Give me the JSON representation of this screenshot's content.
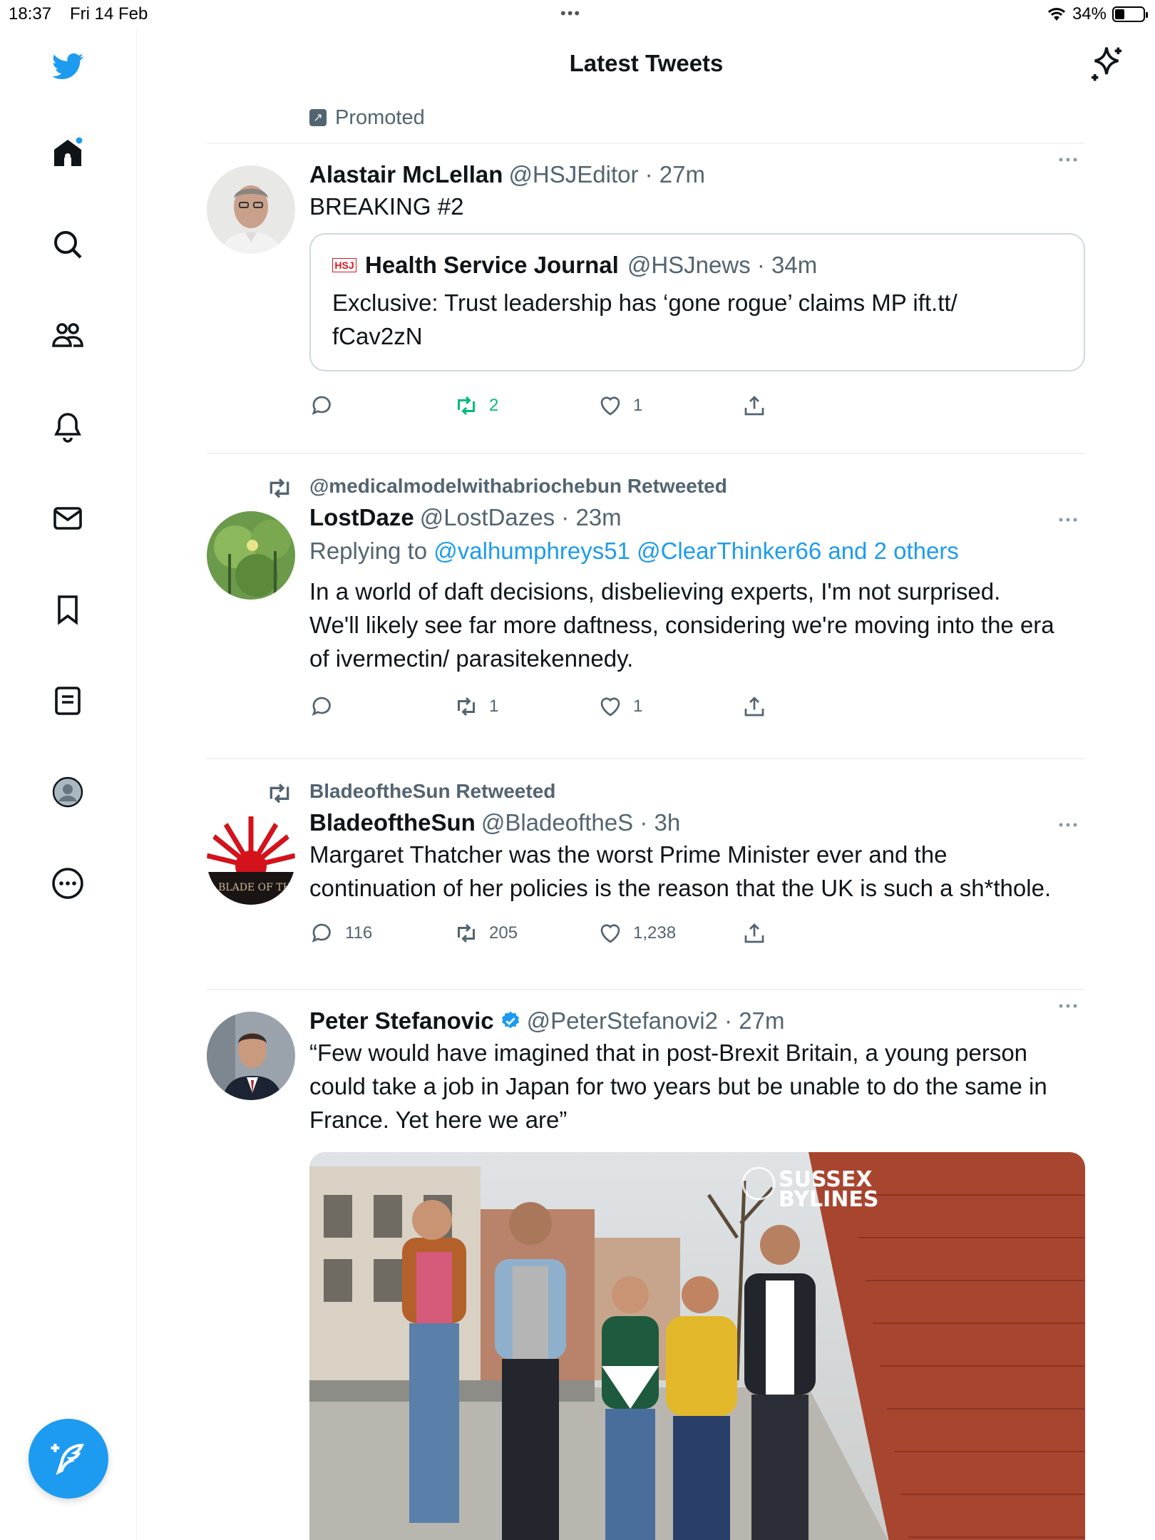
{
  "status_bar": {
    "time": "18:37",
    "date": "Fri 14 Feb",
    "battery": "34%",
    "battery_level": 0.34
  },
  "header": {
    "title": "Latest Tweets"
  },
  "promoted_label": "Promoted",
  "tweets": [
    {
      "name": "Alastair McLellan",
      "meta": "@HSJEditor · 27m",
      "text": "BREAKING #2",
      "quote": {
        "name": "Health Service Journal",
        "meta": "@HSJnews · 34m",
        "text_line1": "Exclusive: Trust leadership has ‘gone rogue’ claims MP ift.tt/",
        "text_line2": "fCav2zN"
      },
      "replies": "",
      "retweets": "2",
      "likes": "1"
    },
    {
      "retweeted_by": "@medicalmodelwithabriochebun Retweeted",
      "name": "LostDaze",
      "meta": "@LostDazes · 23m",
      "replying_prefix": "Replying to ",
      "replying_links": "@valhumphreys51 @ClearThinker66 and 2 others",
      "text_line1": "In a world of daft decisions, disbelieving experts, I'm not surprised.",
      "text_line2": "We'll likely see far more daftness, considering we're moving into the era",
      "text_line3": "of ivermectin/ parasitekennedy.",
      "replies": "",
      "retweets": "1",
      "likes": "1"
    },
    {
      "retweeted_by": "BladeoftheSun Retweeted",
      "name": "BladeoftheSun",
      "meta": "@BladeoftheS · 3h",
      "avatar_text": "BLADE OF THE",
      "text_line1": "Margaret Thatcher was the worst Prime Minister ever and the",
      "text_line2": "continuation of her policies is the reason that the UK is such a sh*thole.",
      "replies": "116",
      "retweets": "205",
      "likes": "1,238"
    },
    {
      "name": "Peter Stefanovic",
      "meta": "@PeterStefanovi2 · 27m",
      "text_line1": "“Few would have imagined that in post-Brexit Britain, a young person",
      "text_line2": "could take a job in Japan for two years but be unable to do the same in",
      "text_line3": "France. Yet here we are”",
      "media_label_1": "SUSSEX",
      "media_label_2": "BYLINES"
    }
  ]
}
